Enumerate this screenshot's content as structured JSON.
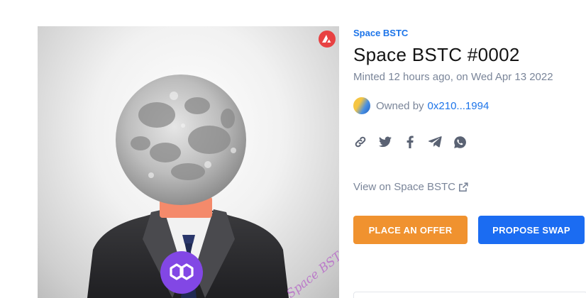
{
  "artwork": {
    "alt": "Space BSTC #0002 artwork",
    "signature_text": "Space BSTC",
    "badge_icon": "polygon-logo-icon",
    "chain_icon": "avalanche-chain-icon",
    "colors": {
      "chain_badge": "#e84142",
      "polygon_badge": "#8247e5"
    }
  },
  "nft": {
    "collection": "Space BSTC",
    "title": "Space BSTC #0002",
    "minted": "Minted 12 hours ago, on Wed Apr 13 2022",
    "owned_by_label": "Owned by",
    "owner_address": "0x210...1994"
  },
  "share": {
    "icons": [
      "link-icon",
      "twitter-icon",
      "facebook-icon",
      "telegram-icon",
      "whatsapp-icon"
    ]
  },
  "view_link": {
    "label": "View on Space BSTC",
    "icon": "external-link-icon"
  },
  "actions": {
    "offer_label": "PLACE AN OFFER",
    "swap_label": "PROPOSE SWAP",
    "colors": {
      "offer": "#f0922f",
      "swap": "#1b6cf2",
      "link": "#1c74e9",
      "muted": "#7a8599"
    }
  }
}
